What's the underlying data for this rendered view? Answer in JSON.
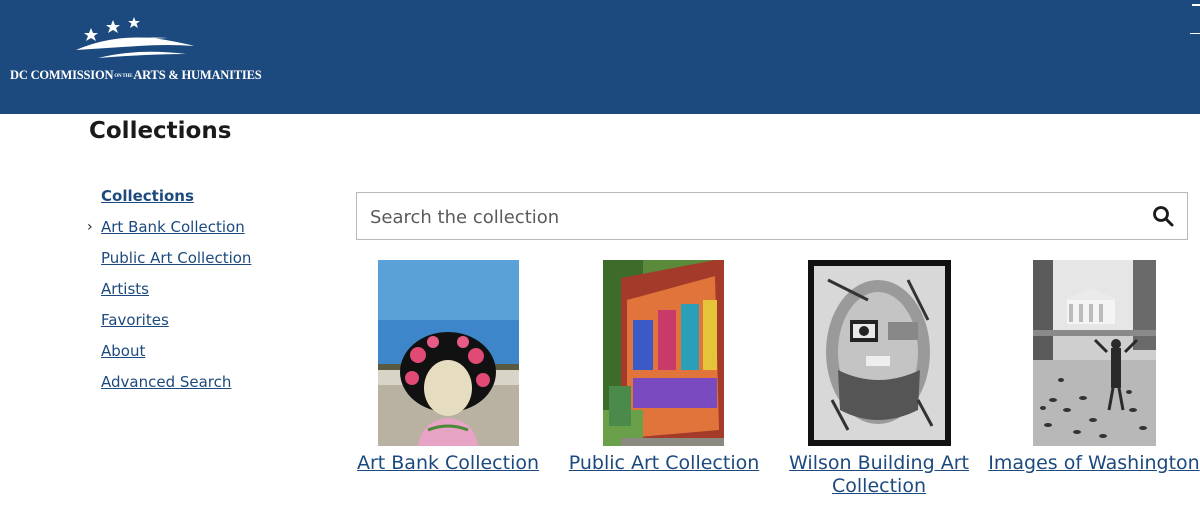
{
  "header": {
    "logo_text_left": "DC COMMISSION",
    "logo_text_small": "ON THE",
    "logo_text_right": "ARTS & HUMANITIES",
    "background": "#1d4a7e"
  },
  "page": {
    "title": "Collections"
  },
  "sidebar": {
    "items": [
      {
        "label": "Collections",
        "active": true
      },
      {
        "label": "Art Bank Collection",
        "has_chevron": true
      },
      {
        "label": "Public Art Collection"
      },
      {
        "label": "Artists"
      },
      {
        "label": "Favorites"
      },
      {
        "label": "About"
      },
      {
        "label": "Advanced Search"
      }
    ]
  },
  "search": {
    "placeholder": "Search the collection",
    "icon": "search-icon"
  },
  "collections": [
    {
      "title": "Art Bank Collection"
    },
    {
      "title": "Public Art Collection"
    },
    {
      "title": "Wilson Building Art Collection"
    },
    {
      "title": "Images of Washington"
    }
  ],
  "colors": {
    "link": "#1d4a7e",
    "header_bg": "#1d4a7e"
  }
}
